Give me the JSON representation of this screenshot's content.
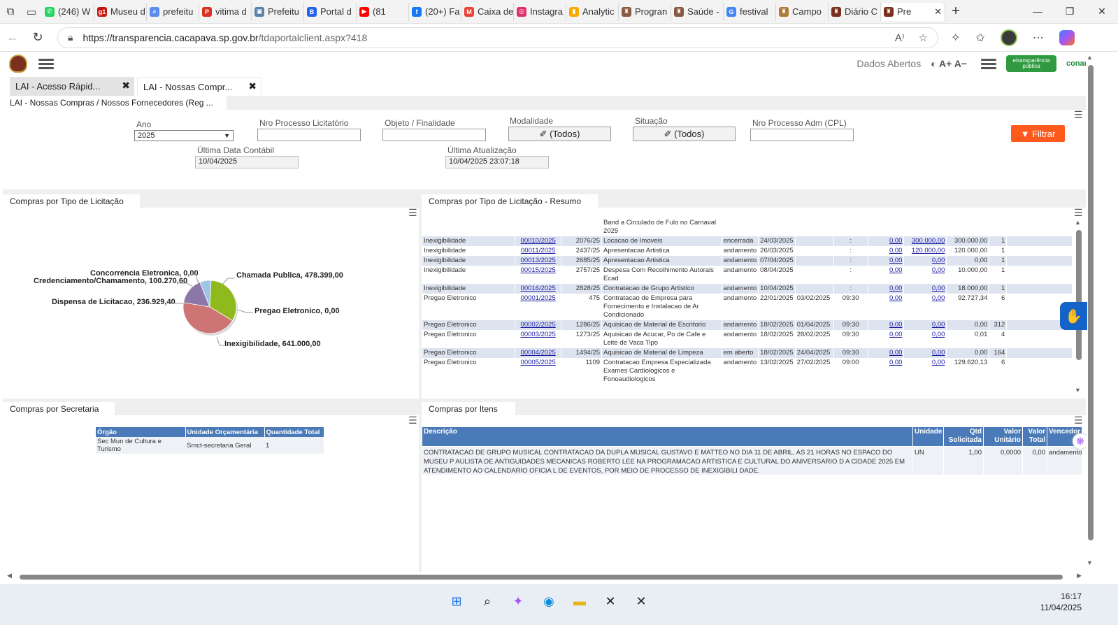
{
  "browser": {
    "tabs": [
      {
        "label": "(246) W",
        "icon": "whatsapp-icon",
        "color": "#25d366",
        "glyph": "✆"
      },
      {
        "label": "Museu d",
        "icon": "g1-icon",
        "color": "#c4170c",
        "glyph": "g1"
      },
      {
        "label": "prefeitu",
        "icon": "search-icon",
        "color": "#5b8def",
        "glyph": "⌕"
      },
      {
        "label": "vitima d",
        "icon": "pdf-icon",
        "color": "#d93025",
        "glyph": "P"
      },
      {
        "label": "Prefeitu",
        "icon": "site-icon",
        "color": "#5a7fa8",
        "glyph": "▣"
      },
      {
        "label": "Portal d",
        "icon": "b-icon",
        "color": "#2563eb",
        "glyph": "B"
      },
      {
        "label": "(81",
        "icon": "youtube-icon",
        "color": "#ff0000",
        "glyph": "▶"
      },
      {
        "label": "(20+) Fa",
        "icon": "facebook-icon",
        "color": "#1877f2",
        "glyph": "f"
      },
      {
        "label": "Caixa de",
        "icon": "gmail-icon",
        "color": "#ea4335",
        "glyph": "M"
      },
      {
        "label": "Instagra",
        "icon": "instagram-icon",
        "color": "#e1306c",
        "glyph": "◎"
      },
      {
        "label": "Analytic",
        "icon": "analytics-icon",
        "color": "#f9ab00",
        "glyph": "▮"
      },
      {
        "label": "Progran",
        "icon": "crest-icon",
        "color": "#8a5a44",
        "glyph": "♜"
      },
      {
        "label": "Saúde -",
        "icon": "crest-icon",
        "color": "#8a5a44",
        "glyph": "♜"
      },
      {
        "label": "festival",
        "icon": "google-icon",
        "color": "#4285f4",
        "glyph": "G"
      },
      {
        "label": "Campo",
        "icon": "crest-icon",
        "color": "#b07a3a",
        "glyph": "♜"
      },
      {
        "label": "Diário C",
        "icon": "crest-icon",
        "color": "#7a2f1f",
        "glyph": "♜"
      },
      {
        "label": "Pre",
        "icon": "crest-icon",
        "color": "#7a2f1f",
        "glyph": "♜",
        "active": true
      }
    ],
    "url_host": "https://transparencia.cacapava.sp.gov.br",
    "url_path": "/tdaportalclient.aspx?418"
  },
  "site": {
    "dados_abertos": "Dados Abertos",
    "font_controls": "◐ A+ A−",
    "etransparencia": "etransparência pública",
    "conam": "conam"
  },
  "app_tabs": [
    "LAI - Acesso Rápid...",
    "LAI - Nossas Compr..."
  ],
  "subtitle": "LAI - Nossas Compras / Nossos Fornecedores (Reg ...",
  "filters": {
    "ano_label": "Ano",
    "ano_value": "2025",
    "nro_proc_label": "Nro Processo Licitatório",
    "objeto_label": "Objeto / Finalidade",
    "modalidade_label": "Modalidade",
    "modalidade_value": "✐ (Todos)",
    "situacao_label": "Situação",
    "situacao_value": "✐ (Todos)",
    "nro_adm_label": "Nro Processo Adm (CPL)",
    "ult_data_label": "Última Data Contábil",
    "ult_data_value": "10/04/2025",
    "ult_atual_label": "Última Atualização",
    "ult_atual_value": "10/04/2025 23:07:18",
    "filtrar_label": "▼ Filtrar"
  },
  "panels": {
    "tipo_title": "Compras por Tipo de Licitação",
    "resumo_title": "Compras por Tipo de Licitação - Resumo",
    "secretaria_title": "Compras por Secretaria",
    "itens_title": "Compras por Itens"
  },
  "chart_data": {
    "type": "pie",
    "title": "",
    "slices": [
      {
        "label": "Chamada Publica",
        "value": 478399.0,
        "display": "Chamada Publica, 478.399,00",
        "color": "#8fba1e"
      },
      {
        "label": "Pregao Eletronico",
        "value": 0.0,
        "display": "Pregao Eletronico, 0,00",
        "color": "#4f6fb0"
      },
      {
        "label": "Inexigibilidade",
        "value": 641000.0,
        "display": "Inexigibilidade, 641.000,00",
        "color": "#cd7474"
      },
      {
        "label": "Dispensa de Licitacao",
        "value": 236929.4,
        "display": "Dispensa de Licitacao, 236.929,40",
        "color": "#8b78a8"
      },
      {
        "label": "Credenciamento/Chamamento",
        "value": 100270.6,
        "display": "Credenciamento/Chamamento, 100.270,60",
        "color": "#9ec4e8"
      },
      {
        "label": "Concorrencia Eletronica",
        "value": 0.0,
        "display": "Concorrencia Eletronica, 0,00",
        "color": "#e0a050"
      }
    ]
  },
  "resumo_rows": [
    {
      "tipo": "",
      "num": "",
      "proc": "",
      "objeto": "Band a Circulado de Fulo no Carnaval 2025",
      "sit": "",
      "d1": "",
      "d2": "",
      "hora": "",
      "v1": "",
      "v2": "",
      "v3": "",
      "q": "",
      "shade": false
    },
    {
      "tipo": "Inexigibilidade",
      "num": "00010/2025",
      "proc": "2076/25",
      "objeto": "Locacao de Imoveis",
      "sit": "encerrada",
      "d1": "24/03/2025",
      "d2": "",
      "hora": ":",
      "v1": "0,00",
      "v2": "300.000,00",
      "v3": "300.000,00",
      "q": "1",
      "shade": true
    },
    {
      "tipo": "Inexigibilidade",
      "num": "00011/2025",
      "proc": "2437/25",
      "objeto": "Apresentacao Artistica",
      "sit": "andamento",
      "d1": "26/03/2025",
      "d2": "",
      "hora": ":",
      "v1": "0,00",
      "v2": "120.000,00",
      "v3": "120.000,00",
      "q": "1",
      "shade": false
    },
    {
      "tipo": "Inexigibilidade",
      "num": "00013/2025",
      "proc": "2685/25",
      "objeto": "Apresentacao Artistica",
      "sit": "andamento",
      "d1": "07/04/2025",
      "d2": "",
      "hora": ":",
      "v1": "0,00",
      "v2": "0,00",
      "v3": "0,00",
      "q": "1",
      "shade": true
    },
    {
      "tipo": "Inexigibilidade",
      "num": "00015/2025",
      "proc": "2757/25",
      "objeto": "Despesa Com Recolhimento Autorais Ecad",
      "sit": "andamento",
      "d1": "08/04/2025",
      "d2": "",
      "hora": ":",
      "v1": "0,00",
      "v2": "0,00",
      "v3": "10.000,00",
      "q": "1",
      "shade": false
    },
    {
      "tipo": "Inexigibilidade",
      "num": "00016/2025",
      "proc": "2828/25",
      "objeto": "Contratacao de Grupo Artistico",
      "sit": "andamento",
      "d1": "10/04/2025",
      "d2": "",
      "hora": ":",
      "v1": "0,00",
      "v2": "0,00",
      "v3": "18.000,00",
      "q": "1",
      "shade": true
    },
    {
      "tipo": "Pregao Eletronico",
      "num": "00001/2025",
      "proc": "475",
      "objeto": "Contratacao de Empresa para Fornecimento e Instalacao de Ar Condicionado",
      "sit": "andamento",
      "d1": "22/01/2025",
      "d2": "03/02/2025",
      "hora": "09:30",
      "v1": "0,00",
      "v2": "0,00",
      "v3": "92.727,34",
      "q": "6",
      "shade": false
    },
    {
      "tipo": "Pregao Eletronico",
      "num": "00002/2025",
      "proc": "1286/25",
      "objeto": "Aquisicao de Material de Escritorio",
      "sit": "andamento",
      "d1": "18/02/2025",
      "d2": "01/04/2025",
      "hora": "09:30",
      "v1": "0,00",
      "v2": "0,00",
      "v3": "0,00",
      "q": "312",
      "shade": true
    },
    {
      "tipo": "Pregao Eletronico",
      "num": "00003/2025",
      "proc": "1273/25",
      "objeto": "Aquisicao de Acucar, Po de Cafe e Leite de Vaca Tipo",
      "sit": "andamento",
      "d1": "18/02/2025",
      "d2": "28/02/2025",
      "hora": "09:30",
      "v1": "0,00",
      "v2": "0,00",
      "v3": "0,01",
      "q": "4",
      "shade": false
    },
    {
      "tipo": "Pregao Eletronico",
      "num": "00004/2025",
      "proc": "1494/25",
      "objeto": "Aquisicao de Material de Limpeza",
      "sit": "em aberto",
      "d1": "18/02/2025",
      "d2": "24/04/2025",
      "hora": "09:30",
      "v1": "0,00",
      "v2": "0,00",
      "v3": "0,00",
      "q": "164",
      "shade": true
    },
    {
      "tipo": "Pregao Eletronico",
      "num": "00005/2025",
      "proc": "1109",
      "objeto": "Contratacao Empresa Especializada Exames Cardiologicos e Fonoaudiologicos",
      "sit": "andamento",
      "d1": "13/02/2025",
      "d2": "27/02/2025",
      "hora": "09:00",
      "v1": "0,00",
      "v2": "0,00",
      "v3": "129.620,13",
      "q": "6",
      "shade": false
    }
  ],
  "secretaria": {
    "headers": [
      "Órgão",
      "Unidade Orçamentária",
      "Quantidade Total"
    ],
    "rows": [
      [
        "Sec Mun de Cultura e Turismo",
        "Smct-secretaria Geral",
        "1"
      ]
    ]
  },
  "itens": {
    "headers": [
      "Descrição",
      "Unidade",
      "Qtd Solicitada",
      "Valor Unitário",
      "Valor Total",
      "Vencedor"
    ],
    "row": {
      "descricao": "CONTRATACAO DE GRUPO MUSICAL CONTRATACAO DA DUPLA MUSICAL GUSTAVO E MATTEO NO DIA 11 DE ABRIL, AS 21 HORAS NO ESPACO DO MUSEU P AULISTA DE ANTIGUIDADES MECANICAS ROBERTO LEE NA PROGRAMACAO ARTISTICA E CULTURAL DO ANIVERSARIO D A CIDADE 2025 EM ATENDIMENTO AO CALENDARIO OFICIA L DE EVENTOS, POR MEIO DE PROCESSO DE INEXIGIBILI DADE.",
      "unidade": "UN",
      "qtd": "1,00",
      "unit": "0,0000",
      "total": "0,00",
      "venc": "andamento"
    }
  },
  "taskbar": {
    "time": "16:17",
    "date": "11/04/2025"
  }
}
